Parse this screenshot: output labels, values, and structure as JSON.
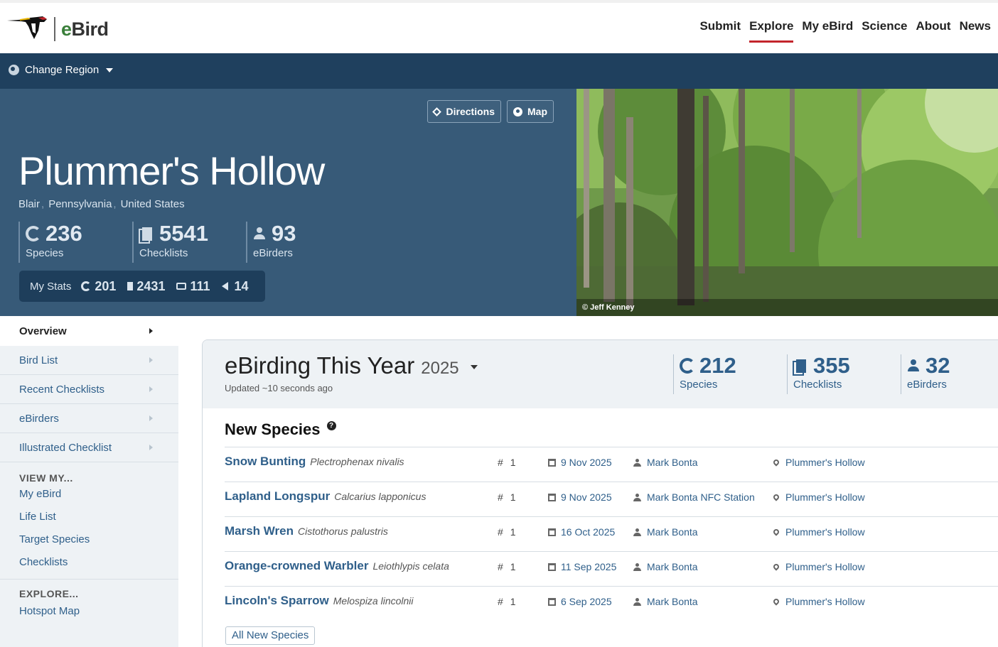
{
  "header": {
    "logo_text_e": "e",
    "logo_text_rest": "Bird",
    "nav": [
      {
        "label": "Submit",
        "active": false
      },
      {
        "label": "Explore",
        "active": true
      },
      {
        "label": "My eBird",
        "active": false
      },
      {
        "label": "Science",
        "active": false
      },
      {
        "label": "About",
        "active": false
      },
      {
        "label": "News",
        "active": false
      }
    ]
  },
  "region": {
    "label": "Change Region"
  },
  "hotspot": {
    "name": "Plummer's Hollow",
    "breadcrumbs": [
      "Blair",
      "Pennsylvania",
      "United States"
    ],
    "buttons": {
      "directions": "Directions",
      "map": "Map"
    },
    "stats": [
      {
        "value": "236",
        "label": "Species",
        "icon": "species-icon"
      },
      {
        "value": "5541",
        "label": "Checklists",
        "icon": "checklist-icon"
      },
      {
        "value": "93",
        "label": "eBirders",
        "icon": "person-icon"
      }
    ],
    "my_stats": {
      "label": "My Stats",
      "species": "201",
      "checklists": "2431",
      "photos": "111",
      "audio": "14"
    },
    "photo_credit": "© Jeff Kenney"
  },
  "sidebar": {
    "primary": [
      {
        "label": "Overview",
        "active": true
      },
      {
        "label": "Bird List",
        "active": false
      },
      {
        "label": "Recent Checklists",
        "active": false
      },
      {
        "label": "eBirders",
        "active": false
      },
      {
        "label": "Illustrated Checklist",
        "active": false
      }
    ],
    "view_my_heading": "VIEW MY...",
    "view_my": [
      "My eBird",
      "Life List",
      "Target Species",
      "Checklists"
    ],
    "explore_heading": "EXPLORE...",
    "explore": [
      "Hotspot Map"
    ]
  },
  "year": {
    "title": "eBirding This Year",
    "year": "2025",
    "updated": "Updated ~10 seconds ago",
    "stats": [
      {
        "value": "212",
        "label": "Species"
      },
      {
        "value": "355",
        "label": "Checklists"
      },
      {
        "value": "32",
        "label": "eBirders"
      }
    ]
  },
  "new_species": {
    "title": "New Species",
    "help": "?",
    "rows": [
      {
        "common": "Snow Bunting",
        "sci": "Plectrophenax nivalis",
        "count": "1",
        "date": "9 Nov 2025",
        "observer": "Mark Bonta",
        "location": "Plummer's Hollow"
      },
      {
        "common": "Lapland Longspur",
        "sci": "Calcarius lapponicus",
        "count": "1",
        "date": "9 Nov 2025",
        "observer": "Mark Bonta NFC Station",
        "location": "Plummer's Hollow"
      },
      {
        "common": "Marsh Wren",
        "sci": "Cistothorus palustris",
        "count": "1",
        "date": "16 Oct 2025",
        "observer": "Mark Bonta",
        "location": "Plummer's Hollow"
      },
      {
        "common": "Orange-crowned Warbler",
        "sci": "Leiothlypis celata",
        "count": "1",
        "date": "11 Sep 2025",
        "observer": "Mark Bonta",
        "location": "Plummer's Hollow"
      },
      {
        "common": "Lincoln's Sparrow",
        "sci": "Melospiza lincolnii",
        "count": "1",
        "date": "6 Sep 2025",
        "observer": "Mark Bonta",
        "location": "Plummer's Hollow"
      }
    ],
    "all_button": "All New Species"
  },
  "colors": {
    "nav_active": "#c3252c",
    "region_bar": "#1f405e",
    "hero": "#375a78",
    "link": "#2f5f8a",
    "logo_green": "#3a7f3a"
  }
}
